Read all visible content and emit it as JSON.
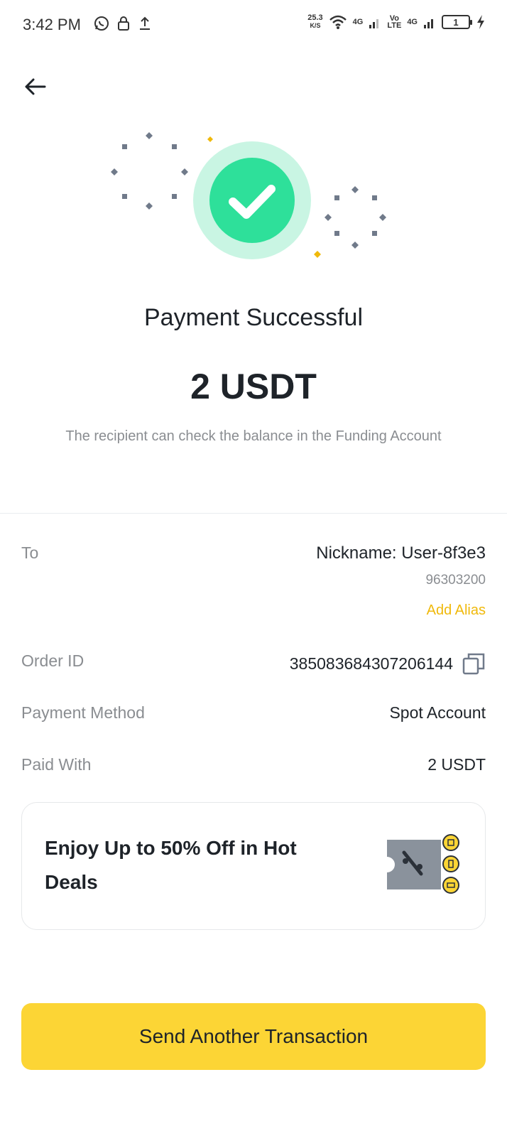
{
  "status_bar": {
    "time": "3:42 PM",
    "speed_value": "25.3",
    "speed_unit": "K/S",
    "net1": "4G",
    "volte_top": "Vo",
    "volte_bottom": "LTE",
    "net2": "4G",
    "battery": "1"
  },
  "header": {
    "back_icon": "arrow-left-icon"
  },
  "result": {
    "title": "Payment Successful",
    "amount": "2 USDT",
    "note": "The recipient can check the balance in the Funding Account"
  },
  "details": {
    "to_label": "To",
    "nickname": "Nickname: User-8f3e3",
    "user_id": "96303200",
    "add_alias": "Add Alias",
    "order_label": "Order ID",
    "order_id": "385083684307206144",
    "method_label": "Payment Method",
    "method_value": "Spot Account",
    "paid_label": "Paid With",
    "paid_value": "2 USDT"
  },
  "promo": {
    "text": "Enjoy Up to 50% Off in Hot Deals"
  },
  "cta": {
    "label": "Send Another Transaction"
  },
  "colors": {
    "accent": "#fcd535",
    "success": "#2ee09a",
    "success_bg": "#c9f5e3",
    "alias": "#f0b90b"
  }
}
